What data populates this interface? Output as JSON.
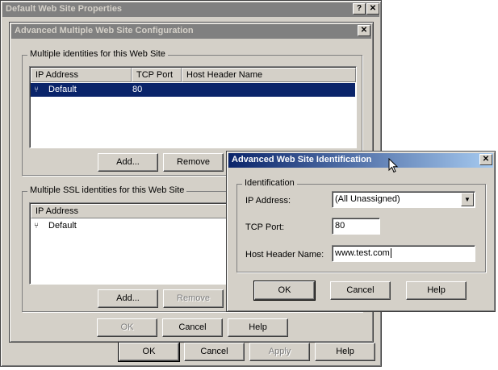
{
  "back_window": {
    "title": "Default Web Site Properties",
    "help_btn": "?",
    "close_btn": "✕",
    "ok": "OK",
    "cancel": "Cancel",
    "apply": "Apply",
    "help": "Help"
  },
  "adv_config": {
    "title": "Advanced Multiple Web Site Configuration",
    "close_btn": "✕",
    "group1": {
      "legend": "Multiple identities for this Web Site",
      "columns": [
        "IP Address",
        "TCP Port",
        "Host Header Name"
      ],
      "rows": [
        {
          "ip": "Default",
          "port": "80",
          "host": ""
        }
      ],
      "add": "Add...",
      "remove": "Remove"
    },
    "group2": {
      "legend": "Multiple SSL identities for this Web Site",
      "columns": [
        "IP Address"
      ],
      "rows": [
        {
          "ip": "Default"
        }
      ],
      "add": "Add...",
      "remove": "Remove"
    },
    "ok": "OK",
    "cancel": "Cancel",
    "help": "Help"
  },
  "ident_dialog": {
    "title": "Advanced Web Site Identification",
    "close_btn": "✕",
    "group_legend": "Identification",
    "ip_label": "IP Address:",
    "ip_value": "(All Unassigned)",
    "port_label": "TCP Port:",
    "port_value": "80",
    "host_label": "Host Header Name:",
    "host_value": "www.test.com",
    "ok": "OK",
    "cancel": "Cancel",
    "help": "Help"
  },
  "icons": {
    "ip_icon": "network-icon",
    "dropdown": "▼"
  }
}
